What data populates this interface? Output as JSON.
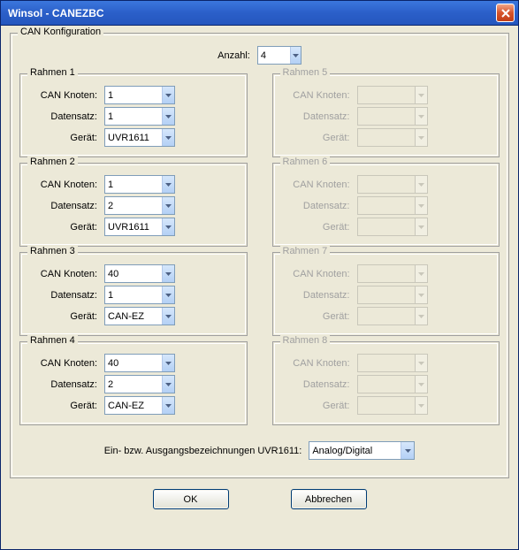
{
  "title": "Winsol - CANEZBC",
  "mainGroup": "CAN Konfiguration",
  "anzahlLabel": "Anzahl:",
  "anzahlValue": "4",
  "labels": {
    "knoten": "CAN Knoten:",
    "datensatz": "Datensatz:",
    "geraet": "Gerät:"
  },
  "frames": [
    {
      "legend": "Rahmen 1",
      "enabled": true,
      "knoten": "1",
      "datensatz": "1",
      "geraet": "UVR1611"
    },
    {
      "legend": "Rahmen 2",
      "enabled": true,
      "knoten": "1",
      "datensatz": "2",
      "geraet": "UVR1611"
    },
    {
      "legend": "Rahmen 3",
      "enabled": true,
      "knoten": "40",
      "datensatz": "1",
      "geraet": "CAN-EZ"
    },
    {
      "legend": "Rahmen 4",
      "enabled": true,
      "knoten": "40",
      "datensatz": "2",
      "geraet": "CAN-EZ"
    },
    {
      "legend": "Rahmen 5",
      "enabled": false,
      "knoten": "",
      "datensatz": "",
      "geraet": ""
    },
    {
      "legend": "Rahmen 6",
      "enabled": false,
      "knoten": "",
      "datensatz": "",
      "geraet": ""
    },
    {
      "legend": "Rahmen 7",
      "enabled": false,
      "knoten": "",
      "datensatz": "",
      "geraet": ""
    },
    {
      "legend": "Rahmen 8",
      "enabled": false,
      "knoten": "",
      "datensatz": "",
      "geraet": ""
    }
  ],
  "ioLabel": "Ein- bzw. Ausgangsbezeichnungen UVR1611:",
  "ioValue": "Analog/Digital",
  "okLabel": "OK",
  "cancelLabel": "Abbrechen"
}
